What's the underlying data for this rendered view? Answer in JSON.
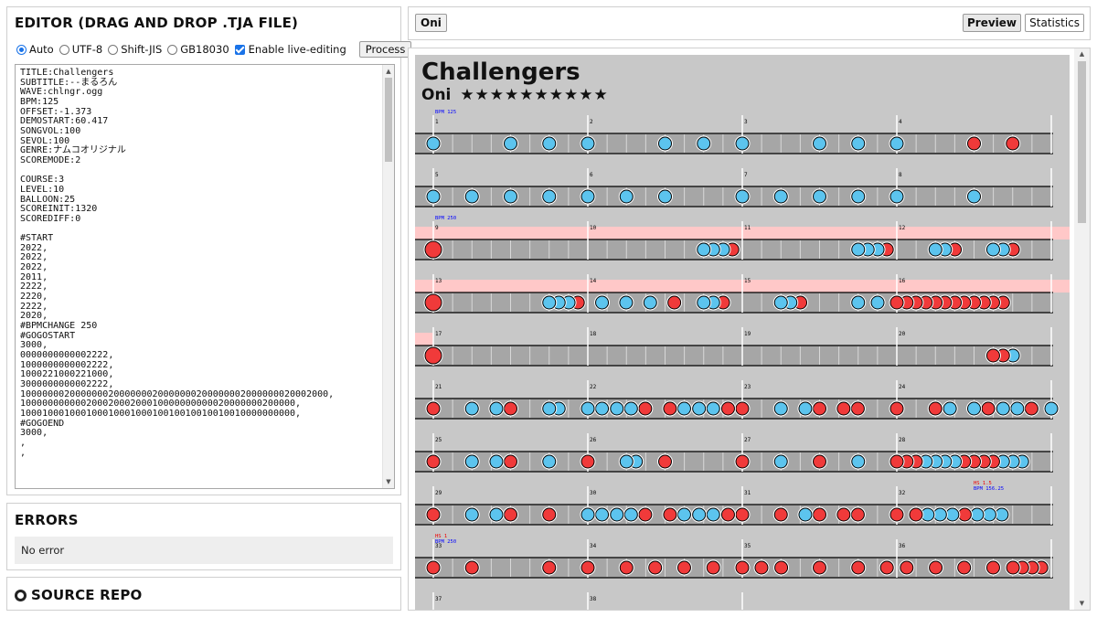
{
  "editor": {
    "title": "EDITOR (DRAG AND DROP .TJA FILE)",
    "encodings": [
      {
        "label": "Auto",
        "selected": true
      },
      {
        "label": "UTF-8",
        "selected": false
      },
      {
        "label": "Shift-JIS",
        "selected": false
      },
      {
        "label": "GB18030",
        "selected": false
      }
    ],
    "live_editing_label": "Enable live-editing",
    "live_editing_checked": true,
    "process_label": "Process",
    "content": "TITLE:Challengers\nSUBTITLE:--まるろん\nWAVE:chlngr.ogg\nBPM:125\nOFFSET:-1.373\nDEMOSTART:60.417\nSONGVOL:100\nSEVOL:100\nGENRE:ナムコオリジナル\nSCOREMODE:2\n\nCOURSE:3\nLEVEL:10\nBALLOON:25\nSCOREINIT:1320\nSCOREDIFF:0\n\n#START\n2022,\n2022,\n2022,\n2011,\n2222,\n2220,\n2222,\n2020,\n#BPMCHANGE 250\n#GOGOSTART\n3000,\n0000000000002222,\n1000000000002222,\n1000221000221000,\n3000000000002222,\n10000000200000002000000020000000200000002000000020002000,\n10000000000020002000200010000000000020000000200000,\n10001000100010001000100010010010010010010000000000,\n#GOGOEND\n3000,\n,\n,"
  },
  "errors": {
    "title": "ERRORS",
    "message": "No error"
  },
  "source": {
    "title": "SOURCE REPO"
  },
  "topbar": {
    "course": "Oni",
    "preview_label": "Preview",
    "statistics_label": "Statistics"
  },
  "chart": {
    "title": "Challengers",
    "course": "Oni",
    "stars": "★★★★★★★★★★",
    "colors": {
      "background": "#c8c8c8",
      "lane": "#a6a6a6",
      "gogo": "#ffc8c8",
      "don": "#f03a3a",
      "ka": "#5cc4ee"
    },
    "rows": [
      {
        "measures": [
          "1",
          "2",
          "3",
          "4"
        ],
        "labels": [
          "BPM 125"
        ],
        "gogo": "none",
        "notes": [
          [
            "k",
            0
          ],
          [
            "k",
            0.125
          ],
          [
            "k",
            0.1875
          ],
          [
            "k",
            0.25
          ],
          [
            "k",
            0.375
          ],
          [
            "k",
            0.4375
          ],
          [
            "k",
            0.5
          ],
          [
            "k",
            0.625
          ],
          [
            "k",
            0.6875
          ],
          [
            "k",
            0.75
          ],
          [
            "d",
            0.875
          ],
          [
            "d",
            0.9375
          ]
        ]
      },
      {
        "measures": [
          "5",
          "6",
          "7",
          "8"
        ],
        "labels": [],
        "gogo": "none",
        "notes": [
          [
            "k",
            0
          ],
          [
            "k",
            0.0625
          ],
          [
            "k",
            0.125
          ],
          [
            "k",
            0.1875
          ],
          [
            "k",
            0.25
          ],
          [
            "k",
            0.3125
          ],
          [
            "k",
            0.375
          ],
          [
            "k",
            0.5
          ],
          [
            "k",
            0.5625
          ],
          [
            "k",
            0.625
          ],
          [
            "k",
            0.6875
          ],
          [
            "k",
            0.75
          ],
          [
            "k",
            0.875
          ]
        ]
      },
      {
        "measures": [
          "9",
          "10",
          "11",
          "12"
        ],
        "labels": [
          "BPM 250"
        ],
        "gogo": "full",
        "notes": [
          [
            "bd",
            0
          ],
          [
            "k",
            0.4375
          ],
          [
            "k",
            0.453
          ],
          [
            "k",
            0.469
          ],
          [
            "d",
            0.484
          ],
          [
            "k",
            0.6875
          ],
          [
            "k",
            0.703
          ],
          [
            "k",
            0.719
          ],
          [
            "d",
            0.734
          ],
          [
            "k",
            0.8125
          ],
          [
            "k",
            0.828
          ],
          [
            "d",
            0.844
          ],
          [
            "k",
            0.906
          ],
          [
            "k",
            0.922
          ],
          [
            "d",
            0.938
          ]
        ]
      },
      {
        "measures": [
          "13",
          "14",
          "15",
          "16"
        ],
        "labels": [],
        "gogo": "full",
        "notes": [
          [
            "bd",
            0
          ],
          [
            "k",
            0.1875
          ],
          [
            "k",
            0.203
          ],
          [
            "k",
            0.219
          ],
          [
            "d",
            0.234
          ],
          [
            "k",
            0.273
          ],
          [
            "k",
            0.312
          ],
          [
            "k",
            0.351
          ],
          [
            "d",
            0.39
          ],
          [
            "k",
            0.4375
          ],
          [
            "k",
            0.453
          ],
          [
            "d",
            0.469
          ],
          [
            "k",
            0.5625
          ],
          [
            "k",
            0.578
          ],
          [
            "d",
            0.594
          ],
          [
            "k",
            0.6875
          ],
          [
            "k",
            0.719
          ],
          [
            "d",
            0.75
          ],
          [
            "d",
            0.766
          ],
          [
            "d",
            0.781
          ],
          [
            "d",
            0.797
          ],
          [
            "d",
            0.813
          ],
          [
            "d",
            0.828
          ],
          [
            "d",
            0.844
          ],
          [
            "d",
            0.859
          ],
          [
            "d",
            0.875
          ],
          [
            "d",
            0.891
          ],
          [
            "d",
            0.906
          ],
          [
            "d",
            0.922
          ]
        ]
      },
      {
        "measures": [
          "17",
          "18",
          "19",
          "20"
        ],
        "labels": [],
        "gogo": "start",
        "notes": [
          [
            "bd",
            0
          ],
          [
            "d",
            0.906
          ],
          [
            "d",
            0.922
          ],
          [
            "k",
            0.938
          ]
        ]
      },
      {
        "measures": [
          "21",
          "22",
          "23",
          "24"
        ],
        "labels": [],
        "gogo": "none",
        "notes": [
          [
            "d",
            0
          ],
          [
            "k",
            0.0625
          ],
          [
            "k",
            0.102
          ],
          [
            "d",
            0.125
          ],
          [
            "k",
            0.1875
          ],
          [
            "k",
            0.203
          ],
          [
            "k",
            0.25
          ],
          [
            "k",
            0.273
          ],
          [
            "k",
            0.297
          ],
          [
            "k",
            0.32
          ],
          [
            "d",
            0.343
          ],
          [
            "d",
            0.383
          ],
          [
            "k",
            0.406
          ],
          [
            "k",
            0.43
          ],
          [
            "k",
            0.453
          ],
          [
            "d",
            0.477
          ],
          [
            "d",
            0.5
          ],
          [
            "k",
            0.5625
          ],
          [
            "k",
            0.602
          ],
          [
            "d",
            0.625
          ],
          [
            "d",
            0.664
          ],
          [
            "d",
            0.687
          ],
          [
            "d",
            0.75
          ],
          [
            "d",
            0.8125
          ],
          [
            "k",
            0.836
          ],
          [
            "k",
            0.875
          ],
          [
            "d",
            0.898
          ],
          [
            "k",
            0.922
          ],
          [
            "k",
            0.945
          ],
          [
            "d",
            0.968
          ],
          [
            "k",
            1.0
          ]
        ]
      },
      {
        "measures": [
          "25",
          "26",
          "27",
          "28"
        ],
        "labels": [],
        "gogo": "none",
        "notes": [
          [
            "d",
            0
          ],
          [
            "k",
            0.0625
          ],
          [
            "k",
            0.102
          ],
          [
            "d",
            0.125
          ],
          [
            "k",
            0.1875
          ],
          [
            "d",
            0.25
          ],
          [
            "k",
            0.3125
          ],
          [
            "k",
            0.328
          ],
          [
            "d",
            0.375
          ],
          [
            "d",
            0.5
          ],
          [
            "k",
            0.5625
          ],
          [
            "d",
            0.625
          ],
          [
            "k",
            0.6875
          ],
          [
            "d",
            0.75
          ],
          [
            "d",
            0.766
          ],
          [
            "d",
            0.781
          ],
          [
            "k",
            0.797
          ],
          [
            "k",
            0.813
          ],
          [
            "k",
            0.828
          ],
          [
            "k",
            0.844
          ],
          [
            "d",
            0.859
          ],
          [
            "d",
            0.875
          ],
          [
            "d",
            0.891
          ],
          [
            "d",
            0.906
          ],
          [
            "k",
            0.922
          ],
          [
            "k",
            0.938
          ],
          [
            "k",
            0.953
          ]
        ]
      },
      {
        "measures": [
          "29",
          "30",
          "31",
          "32"
        ],
        "labels": [
          "HS 1.5",
          "BPM 156.25"
        ],
        "gogo": "none",
        "notes": [
          [
            "d",
            0
          ],
          [
            "k",
            0.0625
          ],
          [
            "k",
            0.102
          ],
          [
            "d",
            0.125
          ],
          [
            "d",
            0.1875
          ],
          [
            "k",
            0.25
          ],
          [
            "k",
            0.273
          ],
          [
            "k",
            0.297
          ],
          [
            "k",
            0.32
          ],
          [
            "d",
            0.343
          ],
          [
            "d",
            0.383
          ],
          [
            "k",
            0.406
          ],
          [
            "k",
            0.43
          ],
          [
            "k",
            0.453
          ],
          [
            "d",
            0.477
          ],
          [
            "d",
            0.5
          ],
          [
            "d",
            0.5625
          ],
          [
            "k",
            0.602
          ],
          [
            "d",
            0.625
          ],
          [
            "d",
            0.664
          ],
          [
            "d",
            0.687
          ],
          [
            "d",
            0.75
          ],
          [
            "d",
            0.781
          ],
          [
            "k",
            0.8
          ],
          [
            "k",
            0.82
          ],
          [
            "k",
            0.84
          ],
          [
            "d",
            0.86
          ],
          [
            "k",
            0.88
          ],
          [
            "k",
            0.9
          ],
          [
            "k",
            0.92
          ]
        ]
      },
      {
        "measures": [
          "33",
          "34",
          "35",
          "36"
        ],
        "labels": [
          "HS 1",
          "BPM 250"
        ],
        "gogo": "none",
        "notes": [
          [
            "d",
            0
          ],
          [
            "d",
            0.0625
          ],
          [
            "d",
            0.1875
          ],
          [
            "d",
            0.25
          ],
          [
            "d",
            0.3125
          ],
          [
            "d",
            0.359
          ],
          [
            "d",
            0.406
          ],
          [
            "d",
            0.453
          ],
          [
            "d",
            0.5
          ],
          [
            "d",
            0.531
          ],
          [
            "d",
            0.563
          ],
          [
            "d",
            0.625
          ],
          [
            "d",
            0.6875
          ],
          [
            "d",
            0.734
          ],
          [
            "d",
            0.766
          ],
          [
            "d",
            0.813
          ],
          [
            "d",
            0.859
          ],
          [
            "d",
            0.906
          ],
          [
            "d",
            0.938
          ],
          [
            "d",
            0.953
          ],
          [
            "d",
            0.969
          ],
          [
            "d",
            0.984
          ]
        ]
      },
      {
        "measures": [
          "37",
          "38"
        ],
        "labels": [],
        "gogo": "none",
        "notes": [
          [
            "d",
            0
          ],
          [
            "k",
            0.031
          ],
          [
            "k",
            0.0625
          ],
          [
            "d",
            0.125
          ],
          [
            "k",
            0.172
          ],
          [
            "k",
            0.219
          ],
          [
            "d",
            0.25
          ],
          [
            "d",
            0.266
          ],
          [
            "d",
            0.281
          ],
          [
            "k",
            0.313
          ],
          [
            "k",
            0.375
          ],
          [
            "d",
            0.406
          ],
          [
            "d",
            0.5
          ],
          [
            "d",
            0.531
          ],
          [
            "d",
            0.563
          ],
          [
            "d",
            0.594
          ],
          [
            "k",
            0.625
          ],
          [
            "k",
            0.641
          ],
          [
            "k",
            0.656
          ],
          [
            "d",
            0.672
          ],
          [
            "d",
            0.75
          ]
        ]
      }
    ]
  }
}
